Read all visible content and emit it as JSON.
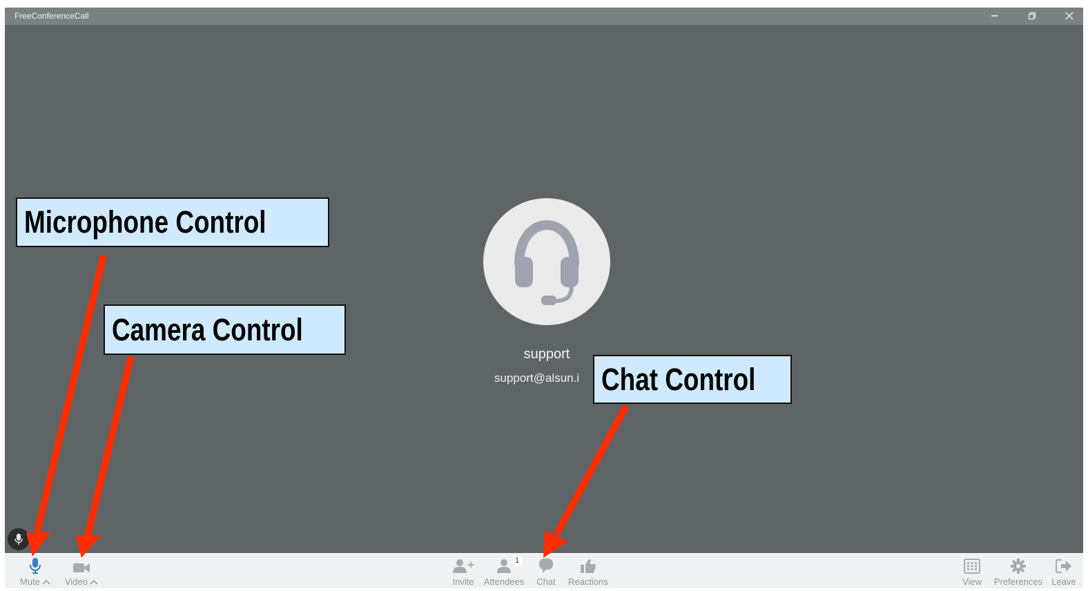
{
  "window": {
    "title": "FreeConferenceCall",
    "controls": [
      "minimize-icon",
      "restore-icon",
      "close-icon"
    ]
  },
  "participant": {
    "name": "support",
    "email": "support@alsun.i",
    "avatar_icon": "headset-icon"
  },
  "toolbar": {
    "left": [
      {
        "label": "Mute",
        "icon": "microphone-icon",
        "has_menu": true
      },
      {
        "label": "Video",
        "icon": "video-camera-icon",
        "has_menu": true
      }
    ],
    "center": [
      {
        "label": "Invite",
        "icon": "add-person-icon"
      },
      {
        "label": "Attendees",
        "icon": "person-icon",
        "badge": "1"
      },
      {
        "label": "Chat",
        "icon": "chat-bubble-icon"
      },
      {
        "label": "Reactions",
        "icon": "thumbs-up-icon"
      }
    ],
    "right": [
      {
        "label": "View",
        "icon": "grid-view-icon"
      },
      {
        "label": "Preferences",
        "icon": "gear-icon"
      },
      {
        "label": "Leave",
        "icon": "leave-icon"
      }
    ]
  },
  "annotations": {
    "microphone": "Microphone Control",
    "camera": "Camera Control",
    "chat": "Chat Control"
  },
  "colors": {
    "app_background": "#5f6466",
    "titlebar": "#7b8082",
    "toolbar": "#f0f1f2",
    "mute_active": "#2f7fd3",
    "callout_fill": "#cfeaff",
    "arrow": "#ff2d00"
  }
}
